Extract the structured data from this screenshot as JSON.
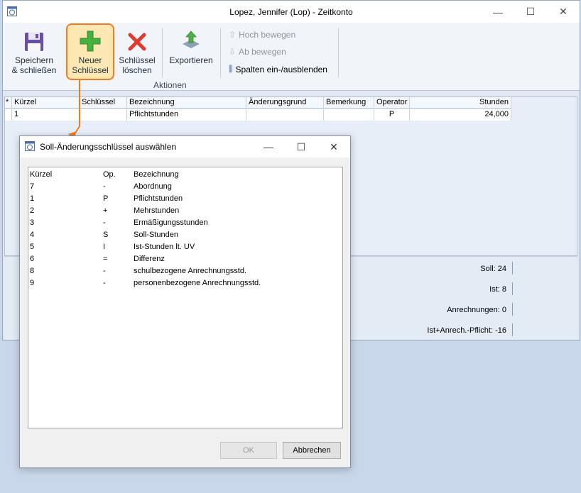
{
  "window": {
    "title": "Lopez, Jennifer (Lop) - Zeitkonto",
    "controls": {
      "minimize": "—",
      "maximize": "☐",
      "close": "✕"
    }
  },
  "ribbon": {
    "save": {
      "line1": "Speichern",
      "line2": "& schließen",
      "icon": "save-disk-icon"
    },
    "new_key": {
      "line1": "Neuer",
      "line2": "Schlüssel",
      "icon": "green-plus-icon"
    },
    "delete_key": {
      "line1": "Schlüssel",
      "line2": "löschen",
      "icon": "red-x-icon"
    },
    "export": {
      "label": "Exportieren",
      "icon": "export-arrow-icon"
    },
    "move_up": "Hoch bewegen",
    "move_down": "Ab bewegen",
    "columns": "Spalten ein-/ausblenden",
    "group_label": "Aktionen",
    "highlight_color": "#f07c1f"
  },
  "grid": {
    "headers": [
      "*",
      "Kürzel",
      "Schlüssel",
      "Bezeichnung",
      "Änderungsgrund",
      "Bemerkung",
      "Operator",
      "Stunden"
    ],
    "rows": [
      [
        "",
        "1",
        "",
        "Pflichtstunden",
        "",
        "",
        "P",
        "24,000"
      ]
    ]
  },
  "summary": {
    "soll": "Soll: 24",
    "ist": "Ist: 8",
    "anrechnungen": "Anrechnungen: 0",
    "ist_anrech": "Ist+Anrech.-Pflicht: -16"
  },
  "dialog": {
    "title": "Soll-Änderungsschlüssel auswählen",
    "controls": {
      "minimize": "—",
      "maximize": "☐",
      "close": "✕"
    },
    "headers": [
      "Kürzel",
      "Op.",
      "Bezeichnung"
    ],
    "rows": [
      [
        "7",
        "-",
        "Abordnung"
      ],
      [
        "1",
        "P",
        "Pflichtstunden"
      ],
      [
        "2",
        "+",
        "Mehrstunden"
      ],
      [
        "3",
        "-",
        "Ermäßigungsstunden"
      ],
      [
        "4",
        "S",
        "Soll-Stunden"
      ],
      [
        "5",
        "I",
        "Ist-Stunden lt. UV"
      ],
      [
        "6",
        "=",
        "Differenz"
      ],
      [
        "8",
        "-",
        "schulbezogene Anrechnungsstd."
      ],
      [
        "9",
        "-",
        "personenbezogene Anrechnungsstd."
      ]
    ],
    "ok": "OK",
    "cancel": "Abbrechen"
  }
}
